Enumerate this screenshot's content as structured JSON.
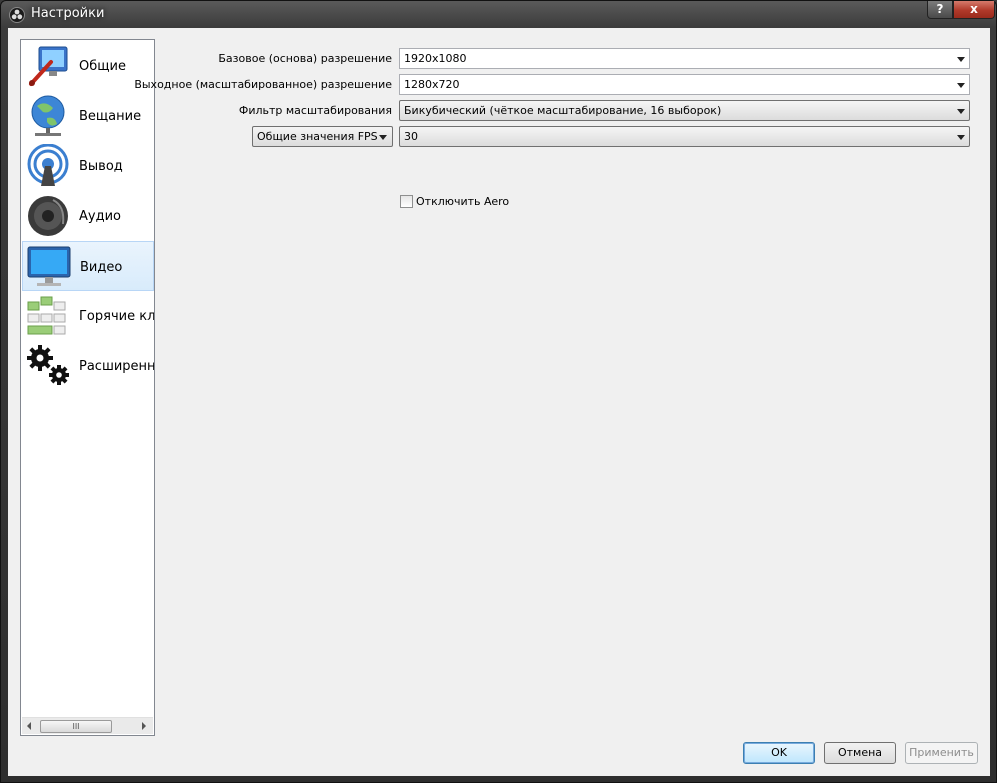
{
  "window": {
    "title": "Настройки",
    "help_label": "?",
    "close_label": "x"
  },
  "sidebar": {
    "items": [
      {
        "label": "Общие",
        "icon": "general-settings-icon",
        "selected": false
      },
      {
        "label": "Вещание",
        "icon": "stream-globe-icon",
        "selected": false
      },
      {
        "label": "Вывод",
        "icon": "output-broadcast-icon",
        "selected": false
      },
      {
        "label": "Аудио",
        "icon": "speaker-icon",
        "selected": false
      },
      {
        "label": "Видео",
        "icon": "monitor-icon",
        "selected": true
      },
      {
        "label": "Горячие кл",
        "icon": "hotkeys-icon",
        "selected": false
      },
      {
        "label": "Расширенн",
        "icon": "gears-icon",
        "selected": false
      }
    ],
    "scroll_thumb": "III"
  },
  "video": {
    "base_resolution_label": "Базовое (основа) разрешение",
    "base_resolution_value": "1920x1080",
    "output_resolution_label": "Выходное (масштабированное) разрешение",
    "output_resolution_value": "1280x720",
    "downscale_filter_label": "Фильтр масштабирования",
    "downscale_filter_value": "Бикубический (чёткое масштабирование, 16 выборок)",
    "fps_type_value": "Общие значения FPS",
    "fps_value": "30",
    "disable_aero_label": "Отключить Aero",
    "disable_aero_checked": false
  },
  "buttons": {
    "ok": "OK",
    "cancel": "Отмена",
    "apply": "Применить"
  },
  "colors": {
    "selection": "#d8ebfb",
    "close_button": "#b0392a",
    "default_button_border": "#3c7fb1"
  }
}
